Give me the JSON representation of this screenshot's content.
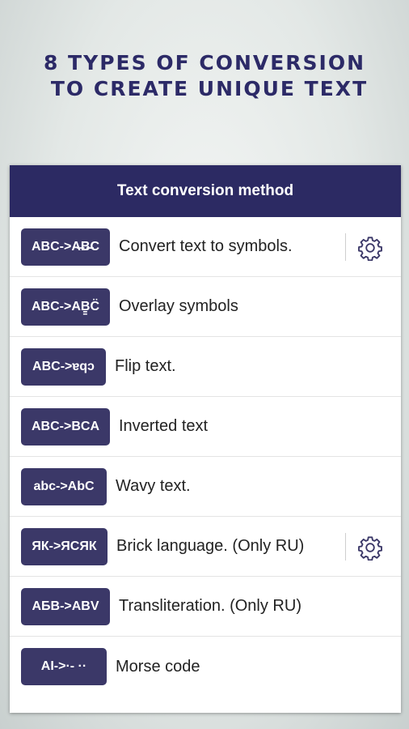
{
  "headline": {
    "line1": "8 TYPES OF CONVERSION",
    "line2": "TO CREATE UNIQUE TEXT"
  },
  "panel": {
    "title": "Text conversion method"
  },
  "methods": [
    {
      "badge": "ABC->A̶B̶C",
      "label": "Convert text to symbols.",
      "has_settings": true,
      "settings_icon": "gear-icon"
    },
    {
      "badge": "ABC->AB̳C̈",
      "label": "Overlay symbols",
      "has_settings": false
    },
    {
      "badge": "ABC->ɐqɔ",
      "label": "Flip text.",
      "has_settings": false
    },
    {
      "badge": "ABC->BCA",
      "label": "Inverted text",
      "has_settings": false
    },
    {
      "badge": "abc->AbC",
      "label": "Wavy text.",
      "has_settings": false
    },
    {
      "badge": "ЯК->ЯСЯК",
      "label": "Brick language. (Only RU)",
      "has_settings": true,
      "settings_icon": "gear-icon"
    },
    {
      "badge": "АБВ->ABV",
      "label": "Transliteration. (Only RU)",
      "has_settings": false
    },
    {
      "badge": "AI->·- ··",
      "label": "Morse code",
      "has_settings": false
    }
  ],
  "colors": {
    "header_bg": "#2c2a63",
    "badge_bg": "#3b3868",
    "headline": "#2c2a67",
    "gear": "#3b3868"
  }
}
